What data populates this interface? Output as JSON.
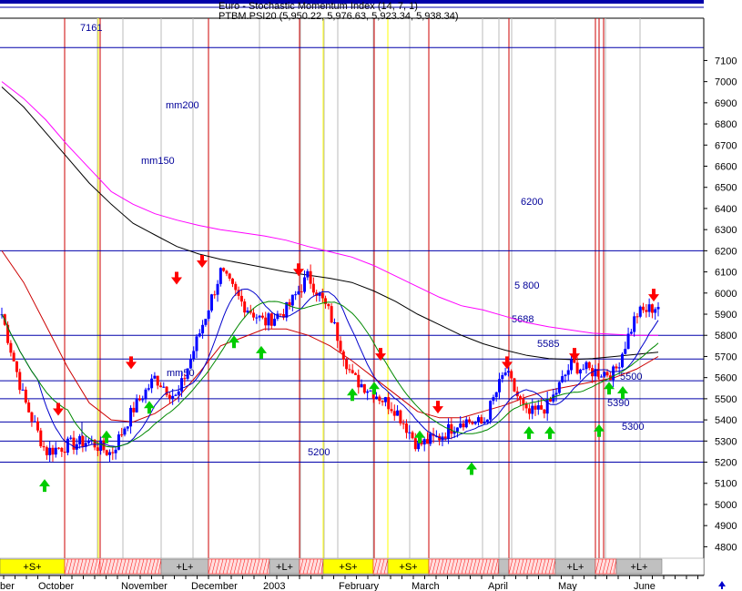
{
  "header": {
    "line1": "Euro - Stochastic Momentum Index (14, 7, 1)",
    "line2": "PTBM.PSI20 (5,950.22, 5,976.63, 5,923.34, 5,938.34)"
  },
  "colors": {
    "price_up": "#0000ff",
    "price_down": "#ff0000",
    "mm200": "#000000",
    "mm150": "#ff00ff",
    "mm50": "#cc0000",
    "ma_short": "#0000cc",
    "ma_mid": "#008800",
    "h_line": "#0000aa",
    "v_red": "#cc0000",
    "v_yellow": "#ffff00",
    "v_gray": "#bbbbbb",
    "band_yellow": "#ffff00",
    "band_gray": "#c0c0c0",
    "band_red": "#ff0000",
    "label_blue": "#000099"
  },
  "chart_data": {
    "type": "candlestick",
    "title": "PTBM.PSI20 (5,950.22, 5,976.63, 5,923.34, 5,938.34)",
    "ylim": [
      4750,
      7300
    ],
    "y_ticks": [
      4800,
      4900,
      5000,
      5100,
      5200,
      5300,
      5400,
      5500,
      5600,
      5700,
      5800,
      5900,
      6000,
      6100,
      6200,
      6300,
      6400,
      6500,
      6600,
      6700,
      6800,
      6900,
      7000,
      7100
    ],
    "x_labels": [
      "ber",
      "October",
      "November",
      "December",
      "2003",
      "February",
      "March",
      "April",
      "May",
      "June"
    ],
    "horizontal_levels": [
      {
        "value": 5200,
        "label": "5200"
      },
      {
        "value": 5300,
        "label": "5300"
      },
      {
        "value": 5390,
        "label": "5390"
      },
      {
        "value": 5500,
        "label": "5500"
      },
      {
        "value": 5585,
        "label": "5585"
      },
      {
        "value": 5688,
        "label": "5688"
      },
      {
        "value": 5800,
        "label": "5 800"
      },
      {
        "value": 6200,
        "label": "6200"
      },
      {
        "value": 7161,
        "label": "7161"
      }
    ],
    "ma_labels": [
      "mm200",
      "mm150",
      "mm50"
    ],
    "series": [
      {
        "name": "mm200",
        "values": [
          6975,
          6880,
          6760,
          6640,
          6520,
          6420,
          6330,
          6275,
          6220,
          6185,
          6160,
          6140,
          6120,
          6100,
          6085,
          6070,
          6050,
          6010,
          5960,
          5900,
          5850,
          5800,
          5760,
          5730,
          5705,
          5690,
          5685,
          5690,
          5700,
          5710,
          5720
        ]
      },
      {
        "name": "mm150",
        "values": [
          7000,
          6920,
          6820,
          6700,
          6590,
          6480,
          6420,
          6375,
          6345,
          6320,
          6300,
          6285,
          6270,
          6250,
          6220,
          6195,
          6170,
          6130,
          6080,
          6030,
          5980,
          5940,
          5920,
          5890,
          5860,
          5840,
          5825,
          5810,
          5805,
          5800,
          5800
        ]
      },
      {
        "name": "mm50",
        "values": [
          6200,
          6050,
          5850,
          5650,
          5480,
          5400,
          5390,
          5430,
          5500,
          5620,
          5750,
          5790,
          5830,
          5830,
          5800,
          5750,
          5680,
          5600,
          5520,
          5440,
          5410,
          5410,
          5440,
          5470,
          5510,
          5540,
          5560,
          5580,
          5600,
          5640,
          5700
        ]
      },
      {
        "name": "close",
        "values": [
          5900,
          5500,
          5250,
          5280,
          5300,
          5240,
          5450,
          5600,
          5500,
          5800,
          6100,
          5950,
          5860,
          5920,
          6080,
          5900,
          5600,
          5530,
          5450,
          5280,
          5320,
          5400,
          5380,
          5630,
          5420,
          5470,
          5660,
          5630,
          5620,
          5900,
          5940
        ]
      }
    ],
    "signal_bands": [
      "+S+",
      "+L+",
      "+L+",
      "+S+",
      "+S+",
      "+L+",
      "+L+"
    ],
    "down_arrows": [
      5420,
      5640,
      6040,
      6120,
      6080,
      5680,
      5430,
      5640,
      5680,
      5960
    ],
    "up_arrows": [
      5120,
      5350,
      5490,
      5800,
      5750,
      5550,
      5580,
      5350,
      5200,
      5370,
      5370,
      5380,
      5560,
      5580
    ]
  }
}
